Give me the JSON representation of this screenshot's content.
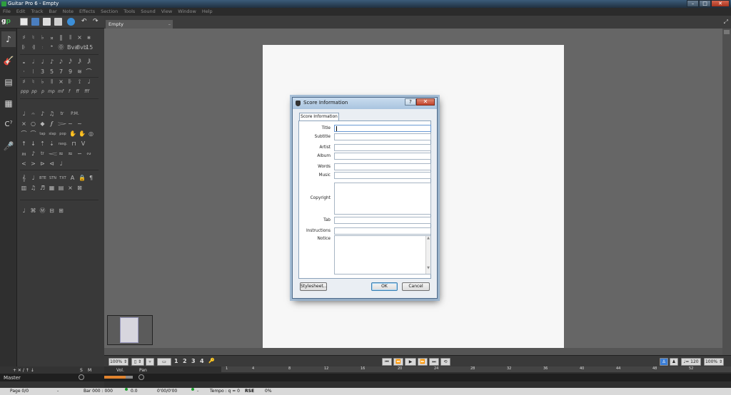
{
  "window": {
    "title": "Guitar Pro 6 - Empty",
    "minimize": "–",
    "maximize": "□",
    "close": "✕"
  },
  "menu": [
    "File",
    "Edit",
    "Track",
    "Bar",
    "Note",
    "Effects",
    "Section",
    "Tools",
    "Sound",
    "View",
    "Window",
    "Help"
  ],
  "logo": {
    "g": "g",
    "p": "p"
  },
  "rail": {
    "note": "♪",
    "guitar": "🎸",
    "amp": "▤",
    "mixer": "▦",
    "chord": "C⁷",
    "mic": "🎤"
  },
  "palette": {
    "row1": [
      "♯",
      "♮",
      "♭",
      "𝄪",
      "‖",
      "𝄂",
      "⨯",
      "⨳"
    ],
    "row2": [
      "𝄆",
      "𝄇",
      "𝄈",
      "𝄌",
      "Ⓞ",
      "Bva",
      "8vb",
      "15"
    ],
    "row3": [
      "𝅝",
      "𝅗𝅥",
      "♩",
      "♪",
      "𝅘𝅥𝅯",
      "𝅘𝅥𝅰",
      "𝅘𝅥𝅱",
      "𝅘𝅥𝅲"
    ],
    "row4": [
      "·",
      "⁝",
      "3",
      "5",
      "7",
      "9",
      "≋",
      "⌒"
    ],
    "row5": [
      "♯",
      "♮",
      "♭",
      "𝄂",
      "⨯",
      "𝄆",
      "⟟",
      "♩"
    ],
    "row6": [
      "ppp",
      "pp",
      "p",
      "mp",
      "mf",
      "f",
      "ff",
      "fff"
    ],
    "row7": [
      "♩",
      "𝄐",
      "♪",
      "♫",
      "tr",
      "P.M."
    ],
    "row8": [
      "⨯",
      "○",
      "◆",
      "𝆑",
      "𝆓",
      "~",
      "~"
    ],
    "row9": [
      "⌒",
      "⌒",
      "tap",
      "slap",
      "pop",
      "✋",
      "✋",
      "◎"
    ],
    "row10": [
      "↑",
      "↓",
      "⇡",
      "⇣",
      "rasg.",
      "⊓",
      "V"
    ],
    "row11": [
      "𝆐",
      "♪",
      "tr",
      "𝆒",
      "≈",
      "≈",
      "∽",
      "∾"
    ],
    "row12": [
      "<",
      ">",
      "⊳",
      "⊲",
      "♩"
    ],
    "row13": [
      "𝄞",
      "♩",
      "BTE",
      "STN",
      "TXT",
      "A",
      "🔒",
      "¶"
    ],
    "row14": [
      "▥",
      "♫",
      "♬",
      "▦",
      "▤",
      "⨯",
      "⊠"
    ],
    "row15": [
      "♩",
      "⌘",
      "Ⓜ",
      "⊟",
      "⊞"
    ]
  },
  "doc_tab": {
    "label": "Empty",
    "close": "–",
    "expand": "⤢"
  },
  "dialog": {
    "title": "Score Information",
    "help": "?",
    "close": "✕",
    "tab": "Score Information",
    "fields": {
      "title": "Title",
      "subtitle": "Subtitle",
      "artist": "Artist",
      "album": "Album",
      "words": "Words",
      "music": "Music",
      "copyright": "Copyright",
      "tab": "Tab",
      "instructions": "Instructions",
      "notice": "Notice"
    },
    "buttons": {
      "stylesheet": "Stylesheet...",
      "ok": "OK",
      "cancel": "Cancel"
    }
  },
  "bottom": {
    "zoom": "100% ⇕",
    "layout": "▯ ⇕",
    "view_mode": "▿",
    "voice_numbers": [
      "1",
      "2",
      "3",
      "4"
    ],
    "tempo": "♩= 120",
    "speed": "100% ⇕"
  },
  "tracks": {
    "header_buttons": "+ ✕  /  ↑  ↓",
    "s": "S",
    "m": "M",
    "vol": "Vol.",
    "pan": "Pan",
    "master": "Master",
    "timeline": [
      "1",
      "4",
      "8",
      "12",
      "16",
      "20",
      "24",
      "28",
      "32",
      "36",
      "40",
      "44",
      "48",
      "52"
    ]
  },
  "status": {
    "page": "Page 0/0",
    "dash": "-",
    "bar": "Bar 000 : 000",
    "pos": "0.0",
    "time": "0'00/0'00",
    "dash2": "-",
    "tempo": "Tempo : q = 0",
    "rse": "RSE",
    "pct": "0%"
  },
  "colors": {
    "accent_green": "#3fb34f",
    "volume_orange": "#e0832e",
    "dialog_border": "#4d6a8a"
  }
}
